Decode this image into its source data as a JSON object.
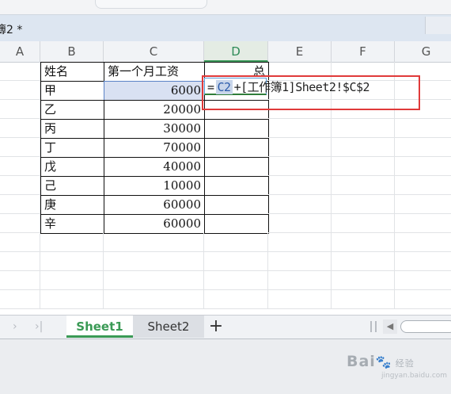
{
  "window": {
    "title": "簿2 *"
  },
  "columns": [
    "A",
    "B",
    "C",
    "D",
    "E",
    "F",
    "G"
  ],
  "selected_column": "D",
  "table": {
    "headers": {
      "name": "姓名",
      "salary": "第一个月工资",
      "total": "总"
    },
    "rows": [
      {
        "name": "甲",
        "salary": "6000"
      },
      {
        "name": "乙",
        "salary": "20000"
      },
      {
        "name": "丙",
        "salary": "30000"
      },
      {
        "name": "丁",
        "salary": "70000"
      },
      {
        "name": "戊",
        "salary": "40000"
      },
      {
        "name": "己",
        "salary": "10000"
      },
      {
        "name": "庚",
        "salary": "60000"
      },
      {
        "name": "辛",
        "salary": "60000"
      }
    ]
  },
  "formula": {
    "eq": "=",
    "ref": "C2",
    "rest": "+[工作簿1]Sheet2!$C$2"
  },
  "tabs": {
    "active": "Sheet1",
    "inactive": "Sheet2",
    "add": "+"
  },
  "watermark": {
    "brand": "Bai",
    "paw": "🐾",
    "suffix": "经验",
    "url": "jingyan.baidu.com"
  },
  "colors": {
    "accent_green": "#3a9a55",
    "highlight_red": "#e03a3a",
    "ref_blue": "#2b5bab"
  }
}
